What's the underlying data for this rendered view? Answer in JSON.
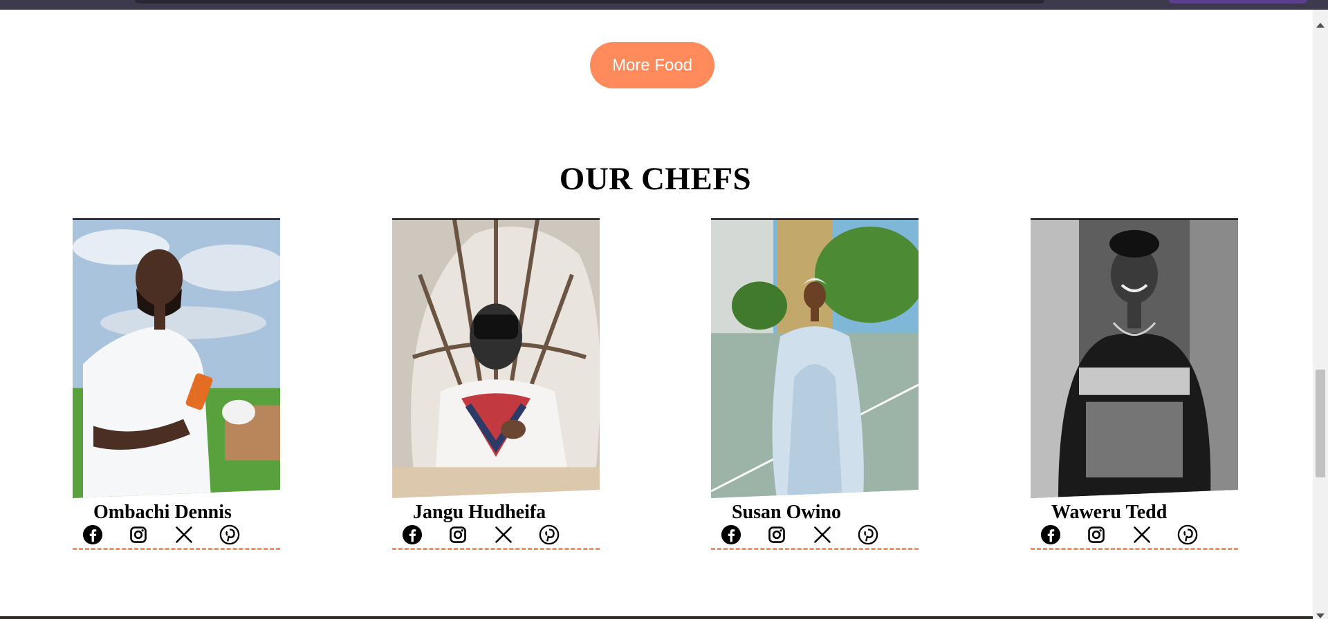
{
  "buttons": {
    "more_food": "More Food"
  },
  "section": {
    "title": "OUR CHEFS"
  },
  "chefs": [
    {
      "name": "Ombachi Dennis"
    },
    {
      "name": "Jangu Hudheifa"
    },
    {
      "name": "Susan Owino"
    },
    {
      "name": "Waweru Tedd"
    }
  ],
  "social_icons": [
    "facebook-icon",
    "instagram-icon",
    "x-icon",
    "pinterest-icon"
  ],
  "colors": {
    "accent": "#ff8a5b",
    "text": "#000000",
    "background": "#ffffff"
  }
}
